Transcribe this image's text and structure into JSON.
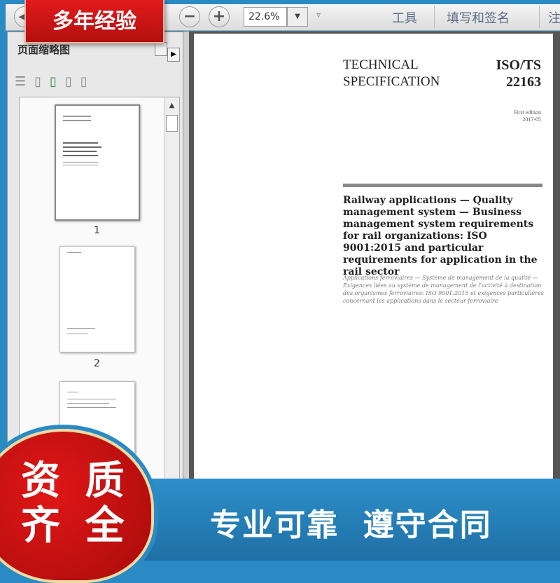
{
  "toolbar": {
    "zoom_value": "22.6%",
    "zoom_out_icon": "minus-circle-icon",
    "zoom_in_icon": "plus-circle-icon",
    "menu": [
      "工具",
      "填写和签名",
      "注"
    ]
  },
  "sidebar": {
    "title": "页面缩略图",
    "pages": [
      "1",
      "2"
    ]
  },
  "document": {
    "doc_type": "TECHNICAL\nSPECIFICATION",
    "doc_number": "ISO/TS\n22163",
    "edition": "First edition\n2017-05",
    "title": "Railway applications — Quality management system — Business management system requirements for rail organizations: ISO 9001:2015 and particular requirements for application in the rail sector",
    "subtitle": "Applications ferroviaires — Système de management de la qualité — Exigences liées au système de management de l'activité à destination des organismes ferroviaires: ISO 9001:2015 et exigences particulières concernant les applications dans le secteur ferroviaire"
  },
  "overlay": {
    "ribbon": "多年经验",
    "cloud_line1": "资 质",
    "cloud_line2": "齐 全",
    "slogan": "专业可靠  遵守合同"
  },
  "colors": {
    "frame": "#2a8ac4",
    "accent_red": "#d01414"
  }
}
